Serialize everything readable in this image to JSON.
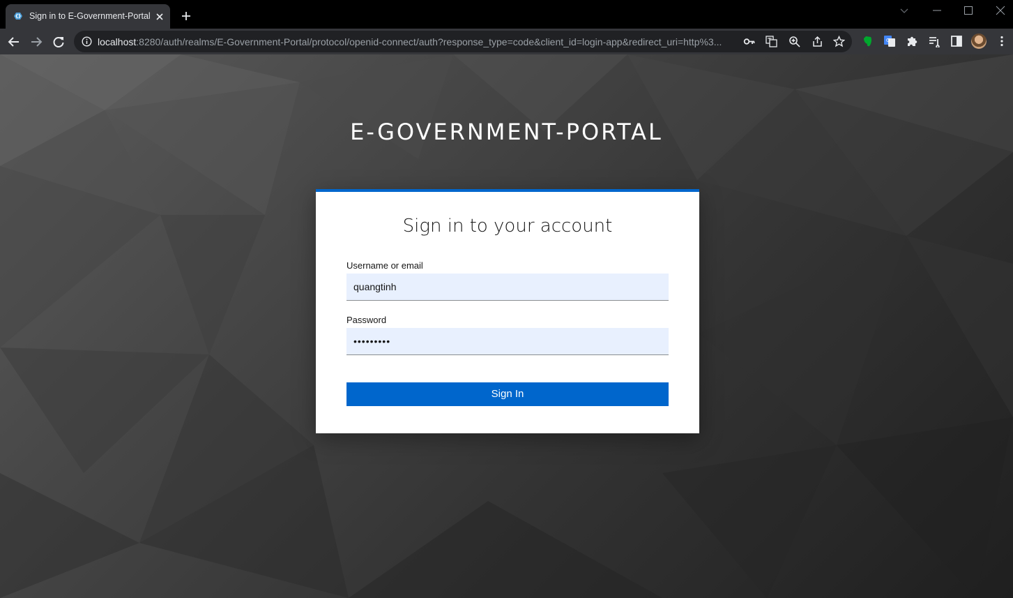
{
  "browser": {
    "tab_title": "Sign in to E-Government-Portal",
    "url_host": "localhost",
    "url_rest": ":8280/auth/realms/E-Government-Portal/protocol/openid-connect/auth?response_type=code&client_id=login-app&redirect_uri=http%3..."
  },
  "page": {
    "realm_title": "E-GOVERNMENT-PORTAL",
    "card_title": "Sign in to your account",
    "username_label": "Username or email",
    "username_value": "quangtinh",
    "password_label": "Password",
    "password_value": "•••••••••",
    "signin_label": "Sign In"
  },
  "colors": {
    "accent": "#0066cc",
    "field_bg": "#e8f0fe",
    "tab_active": "#35363a"
  },
  "icons": {
    "tab": [
      "keycloak-favicon-icon",
      "close-icon",
      "plus-icon"
    ],
    "window": [
      "chevron-down-icon",
      "minimize-icon",
      "maximize-icon",
      "close-icon"
    ],
    "nav": [
      "back-arrow-icon",
      "forward-arrow-icon",
      "reload-icon",
      "info-icon"
    ],
    "omnibox": [
      "key-icon",
      "translate-icon",
      "zoom-icon",
      "share-icon",
      "star-icon"
    ],
    "extensions": [
      "evernote-icon",
      "google-translate-icon",
      "puzzle-icon",
      "reading-list-icon",
      "side-panel-icon",
      "avatar",
      "more-vert-icon"
    ]
  }
}
